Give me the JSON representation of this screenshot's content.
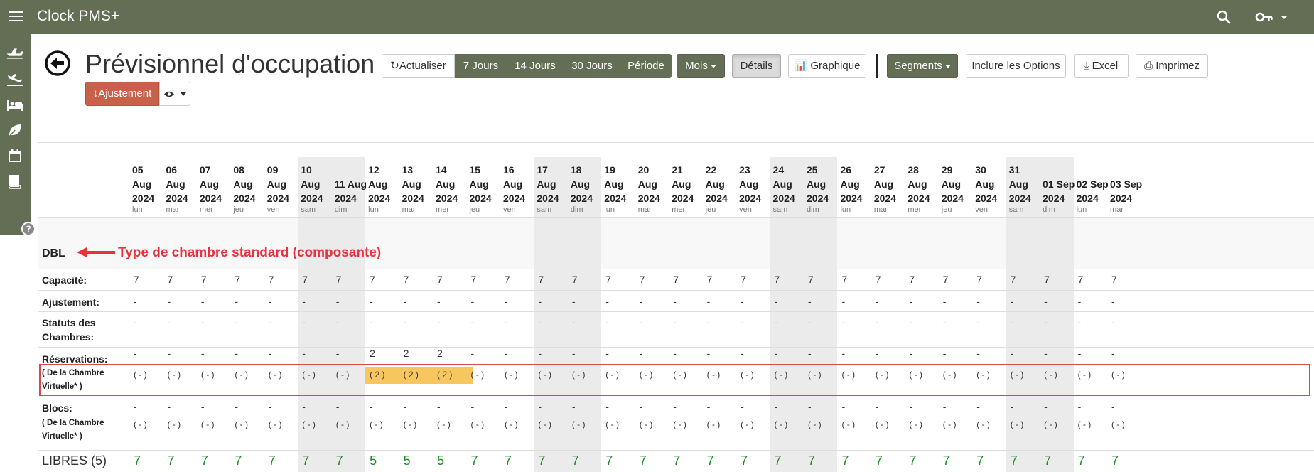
{
  "app": {
    "title": "Clock PMS+"
  },
  "page": {
    "title": "Prévisionnel d'occupation"
  },
  "toolbar": {
    "refresh": "Actualiser",
    "periods": [
      "7 Jours",
      "14 Jours",
      "30 Jours",
      "Période"
    ],
    "month": "Mois",
    "details": "Détails",
    "chart": "Graphique",
    "segments": "Segments",
    "include_options": "Inclure les Options",
    "excel": "Excel",
    "print": "Imprimez",
    "adjust": "Ajustement"
  },
  "colors": {
    "topbar": "#636e55",
    "highlight": "#f7c65e",
    "free_green": "#1f8a28",
    "annotation_red": "#e8333c"
  },
  "icons": {
    "menu": "hamburger-icon",
    "search": "search-icon",
    "key": "key-icon",
    "back": "back-arrow-icon",
    "refresh": "refresh-icon",
    "chart": "bar-chart-icon",
    "excel": "download-icon",
    "print": "printer-icon",
    "adjust": "vertical-resize-icon",
    "eye": "eye-icon",
    "help": "help-icon"
  },
  "sidebar_icons": [
    "departures-icon",
    "arrivals-icon",
    "bed-icon",
    "leaf-icon",
    "calendar-icon",
    "book-icon"
  ],
  "dates": [
    {
      "line1": "05",
      "line2": "Aug",
      "line3": "2024",
      "dow": "lun"
    },
    {
      "line1": "06",
      "line2": "Aug",
      "line3": "2024",
      "dow": "mar"
    },
    {
      "line1": "07",
      "line2": "Aug",
      "line3": "2024",
      "dow": "mer"
    },
    {
      "line1": "08",
      "line2": "Aug",
      "line3": "2024",
      "dow": "jeu"
    },
    {
      "line1": "09",
      "line2": "Aug",
      "line3": "2024",
      "dow": "ven"
    },
    {
      "line1": "10",
      "line2": "Aug",
      "line3": "2024",
      "dow": "sam",
      "weekend": true
    },
    {
      "line1": "",
      "line2": "11 Aug",
      "line3": "2024",
      "dow": "dim",
      "weekend": true
    },
    {
      "line1": "12",
      "line2": "Aug",
      "line3": "2024",
      "dow": "lun"
    },
    {
      "line1": "13",
      "line2": "Aug",
      "line3": "2024",
      "dow": "mar"
    },
    {
      "line1": "14",
      "line2": "Aug",
      "line3": "2024",
      "dow": "mer"
    },
    {
      "line1": "15",
      "line2": "Aug",
      "line3": "2024",
      "dow": "jeu"
    },
    {
      "line1": "16",
      "line2": "Aug",
      "line3": "2024",
      "dow": "ven"
    },
    {
      "line1": "17",
      "line2": "Aug",
      "line3": "2024",
      "dow": "sam",
      "weekend": true
    },
    {
      "line1": "18",
      "line2": "Aug",
      "line3": "2024",
      "dow": "dim",
      "weekend": true
    },
    {
      "line1": "19",
      "line2": "Aug",
      "line3": "2024",
      "dow": "lun"
    },
    {
      "line1": "20",
      "line2": "Aug",
      "line3": "2024",
      "dow": "mar"
    },
    {
      "line1": "21",
      "line2": "Aug",
      "line3": "2024",
      "dow": "mer"
    },
    {
      "line1": "22",
      "line2": "Aug",
      "line3": "2024",
      "dow": "jeu"
    },
    {
      "line1": "23",
      "line2": "Aug",
      "line3": "2024",
      "dow": "ven"
    },
    {
      "line1": "24",
      "line2": "Aug",
      "line3": "2024",
      "dow": "sam",
      "weekend": true
    },
    {
      "line1": "25",
      "line2": "Aug",
      "line3": "2024",
      "dow": "dim",
      "weekend": true
    },
    {
      "line1": "26",
      "line2": "Aug",
      "line3": "2024",
      "dow": "lun"
    },
    {
      "line1": "27",
      "line2": "Aug",
      "line3": "2024",
      "dow": "mar"
    },
    {
      "line1": "28",
      "line2": "Aug",
      "line3": "2024",
      "dow": "mer"
    },
    {
      "line1": "29",
      "line2": "Aug",
      "line3": "2024",
      "dow": "jeu"
    },
    {
      "line1": "30",
      "line2": "Aug",
      "line3": "2024",
      "dow": "ven"
    },
    {
      "line1": "31",
      "line2": "Aug",
      "line3": "2024",
      "dow": "sam",
      "weekend": true
    },
    {
      "line1": "",
      "line2": "01 Sep",
      "line3": "2024",
      "dow": "dim",
      "weekend": true
    },
    {
      "line1": "",
      "line2": "02 Sep",
      "line3": "2024",
      "dow": "lun"
    },
    {
      "line1": "",
      "line2": "03 Sep",
      "line3": "2024",
      "dow": "mar"
    }
  ],
  "section": {
    "room_type": "DBL",
    "annotation": "Type de chambre standard (composante)",
    "rows": {
      "capacity": {
        "label": "Capacité:",
        "values": [
          "7",
          "7",
          "7",
          "7",
          "7",
          "7",
          "7",
          "7",
          "7",
          "7",
          "7",
          "7",
          "7",
          "7",
          "7",
          "7",
          "7",
          "7",
          "7",
          "7",
          "7",
          "7",
          "7",
          "7",
          "7",
          "7",
          "7",
          "7",
          "7",
          "7"
        ]
      },
      "adjustment": {
        "label": "Ajustement:",
        "values": [
          "-",
          "-",
          "-",
          "-",
          "-",
          "-",
          "-",
          "-",
          "-",
          "-",
          "-",
          "-",
          "-",
          "-",
          "-",
          "-",
          "-",
          "-",
          "-",
          "-",
          "-",
          "-",
          "-",
          "-",
          "-",
          "-",
          "-",
          "-",
          "-",
          "-"
        ]
      },
      "room_status": {
        "label_line1": "Statuts des",
        "label_line2": "Chambres:",
        "values": [
          "-",
          "-",
          "-",
          "-",
          "-",
          "-",
          "-",
          "-",
          "-",
          "-",
          "-",
          "-",
          "-",
          "-",
          "-",
          "-",
          "-",
          "-",
          "-",
          "-",
          "-",
          "-",
          "-",
          "-",
          "-",
          "-",
          "-",
          "-",
          "-",
          "-"
        ]
      },
      "reservations": {
        "label": "Réservations:",
        "sub_line1": "( De la Chambre",
        "sub_line2": "Virtuelle* )",
        "values": [
          "-",
          "-",
          "-",
          "-",
          "-",
          "-",
          "-",
          "2",
          "2",
          "2",
          "-",
          "-",
          "-",
          "-",
          "-",
          "-",
          "-",
          "-",
          "-",
          "-",
          "-",
          "-",
          "-",
          "-",
          "-",
          "-",
          "-",
          "-",
          "-",
          "-"
        ],
        "virtual": [
          "( - )",
          "( - )",
          "( - )",
          "( - )",
          "( - )",
          "( - )",
          "( - )",
          "( 2 )",
          "( 2 )",
          "( 2 )",
          "( - )",
          "( - )",
          "( - )",
          "( - )",
          "( - )",
          "( - )",
          "( - )",
          "( - )",
          "( - )",
          "( - )",
          "( - )",
          "( - )",
          "( - )",
          "( - )",
          "( - )",
          "( - )",
          "( - )",
          "( - )",
          "( - )",
          "( - )"
        ],
        "highlighted": [
          7,
          8,
          9
        ]
      },
      "blocks": {
        "label": "Blocs:",
        "sub_line1": "( De la Chambre",
        "sub_line2": "Virtuelle* )",
        "values": [
          "-",
          "-",
          "-",
          "-",
          "-",
          "-",
          "-",
          "-",
          "-",
          "-",
          "-",
          "-",
          "-",
          "-",
          "-",
          "-",
          "-",
          "-",
          "-",
          "-",
          "-",
          "-",
          "-",
          "-",
          "-",
          "-",
          "-",
          "-",
          "-",
          "-"
        ],
        "virtual": [
          "( - )",
          "( - )",
          "( - )",
          "( - )",
          "( - )",
          "( - )",
          "( - )",
          "( - )",
          "( - )",
          "( - )",
          "( - )",
          "( - )",
          "( - )",
          "( - )",
          "( - )",
          "( - )",
          "( - )",
          "( - )",
          "( - )",
          "( - )",
          "( - )",
          "( - )",
          "( - )",
          "( - )",
          "( - )",
          "( - )",
          "( - )",
          "( - )",
          "( - )",
          "( - )"
        ]
      },
      "free": {
        "label": "LIBRES (5)",
        "values": [
          "7",
          "7",
          "7",
          "7",
          "7",
          "7",
          "7",
          "5",
          "5",
          "5",
          "7",
          "7",
          "7",
          "7",
          "7",
          "7",
          "7",
          "7",
          "7",
          "7",
          "7",
          "7",
          "7",
          "7",
          "7",
          "7",
          "7",
          "7",
          "7",
          "7"
        ]
      }
    }
  }
}
